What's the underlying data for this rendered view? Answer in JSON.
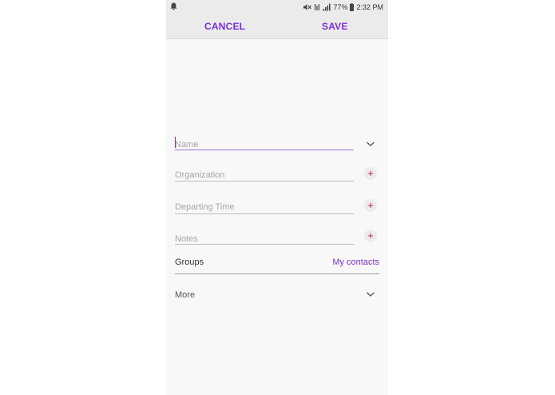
{
  "status_bar": {
    "battery_percent": "77%",
    "time": "2:32 PM"
  },
  "toolbar": {
    "cancel_label": "CANCEL",
    "save_label": "SAVE"
  },
  "form": {
    "name_placeholder": "Name",
    "organization_placeholder": "Organization",
    "departing_time_placeholder": "Departing Time",
    "notes_placeholder": "Notes",
    "groups_label": "Groups",
    "groups_value": "My contacts",
    "more_label": "More"
  },
  "colors": {
    "accent": "#7b2fd6",
    "plus_icon": "#c2185b",
    "background": "#f8f8f8",
    "toolbar_bg": "#ebebeb"
  },
  "icons": {
    "status_left": "notification-icon",
    "status_right": [
      "mute-icon",
      "wifi-icon",
      "signal-icon",
      "battery-icon"
    ],
    "name_expand": "chevron-down-icon",
    "add": "plus-icon",
    "more_expand": "chevron-down-icon"
  }
}
